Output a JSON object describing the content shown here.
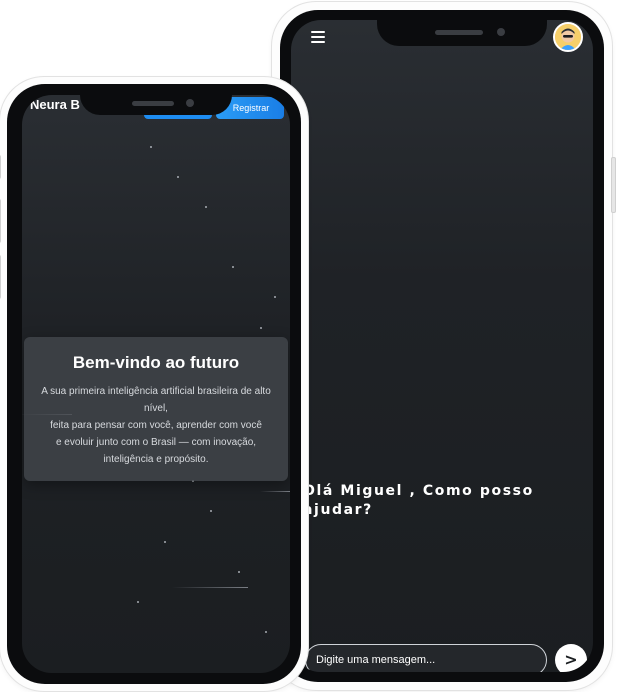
{
  "welcome_phone": {
    "brand": "Neura B",
    "login_label": "",
    "register_label": "Registrar",
    "card": {
      "title": "Bem-vindo ao futuro",
      "lines": [
        "A sua primeira inteligência artificial brasileira de alto nível,",
        "feita para pensar com você, aprender com você",
        "e evoluir junto com o Brasil — com inovação,",
        "inteligência e propósito."
      ]
    }
  },
  "chat_phone": {
    "menu_icon": "hamburger-menu-icon",
    "avatar_icon": "user-avatar-icon",
    "greeting_line1": "Olá Miguel , Como posso",
    "greeting_line2": "ajudar?",
    "input": {
      "value": "",
      "placeholder": "Digite uma mensagem..."
    },
    "send_label": ">"
  },
  "colors": {
    "screen_bg": "#1f2226",
    "accent_blue": "#1e8df2",
    "card_bg": "#44484d",
    "text": "#ffffff"
  }
}
